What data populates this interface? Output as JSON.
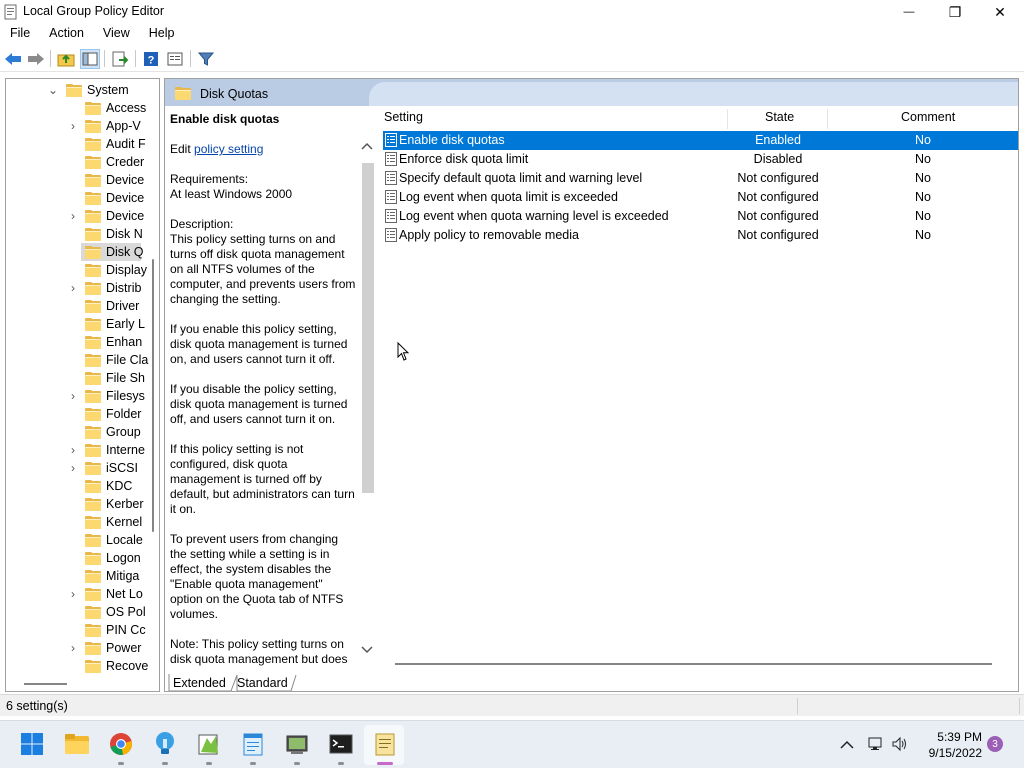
{
  "window": {
    "title": "Local Group Policy Editor",
    "minimize_glyph": "—",
    "maximize_glyph": "❐",
    "close_glyph": "✕"
  },
  "menu": [
    "File",
    "Action",
    "View",
    "Help"
  ],
  "toolbar": {
    "icons": [
      "back-arrow-icon",
      "forward-arrow-icon",
      "up-folder-icon",
      "show-hide-tree-icon",
      "export-list-icon",
      "help-icon",
      "properties-icon",
      "filter-icon"
    ]
  },
  "tree": {
    "items": [
      {
        "label": "System",
        "expander": "⌄",
        "selected": false
      },
      {
        "label": "Access",
        "expander": "",
        "selected": false
      },
      {
        "label": "App-V",
        "expander": "›",
        "selected": false
      },
      {
        "label": "Audit F",
        "expander": "",
        "selected": false
      },
      {
        "label": "Creder",
        "expander": "",
        "selected": false
      },
      {
        "label": "Device",
        "expander": "",
        "selected": false
      },
      {
        "label": "Device",
        "expander": "",
        "selected": false
      },
      {
        "label": "Device",
        "expander": "›",
        "selected": false
      },
      {
        "label": "Disk N",
        "expander": "",
        "selected": false
      },
      {
        "label": "Disk Q",
        "expander": "",
        "selected": true
      },
      {
        "label": "Display",
        "expander": "",
        "selected": false
      },
      {
        "label": "Distrib",
        "expander": "›",
        "selected": false
      },
      {
        "label": "Driver",
        "expander": "",
        "selected": false
      },
      {
        "label": "Early L",
        "expander": "",
        "selected": false
      },
      {
        "label": "Enhan",
        "expander": "",
        "selected": false
      },
      {
        "label": "File Cla",
        "expander": "",
        "selected": false
      },
      {
        "label": "File Sh",
        "expander": "",
        "selected": false
      },
      {
        "label": "Filesys",
        "expander": "›",
        "selected": false
      },
      {
        "label": "Folder",
        "expander": "",
        "selected": false
      },
      {
        "label": "Group",
        "expander": "",
        "selected": false
      },
      {
        "label": "Interne",
        "expander": "›",
        "selected": false
      },
      {
        "label": "iSCSI",
        "expander": "›",
        "selected": false
      },
      {
        "label": "KDC",
        "expander": "",
        "selected": false
      },
      {
        "label": "Kerber",
        "expander": "",
        "selected": false
      },
      {
        "label": "Kernel",
        "expander": "",
        "selected": false
      },
      {
        "label": "Locale",
        "expander": "",
        "selected": false
      },
      {
        "label": "Logon",
        "expander": "",
        "selected": false
      },
      {
        "label": "Mitiga",
        "expander": "",
        "selected": false
      },
      {
        "label": "Net Lo",
        "expander": "›",
        "selected": false
      },
      {
        "label": "OS Pol",
        "expander": "",
        "selected": false
      },
      {
        "label": "PIN Cc",
        "expander": "",
        "selected": false
      },
      {
        "label": "Power",
        "expander": "›",
        "selected": false
      },
      {
        "label": "Recove",
        "expander": "",
        "selected": false
      }
    ]
  },
  "header": {
    "title": "Disk Quotas"
  },
  "description": {
    "heading": "Enable disk quotas",
    "edit_prefix": "Edit ",
    "edit_link": "policy setting",
    "requirements_label": "Requirements:",
    "requirements_value": "At least Windows 2000",
    "description_label": "Description:",
    "paragraphs": [
      "This policy setting turns on and turns off disk quota management on all NTFS volumes of the computer, and prevents users from changing the setting.",
      "If you enable this policy setting, disk quota management is turned on, and users cannot turn it off.",
      "If you disable the policy setting, disk quota management is turned off, and users cannot turn it on.",
      "If this policy setting is not configured, disk quota management is turned off by default, but administrators can turn it on.",
      "To prevent users from changing the setting while a setting is in effect, the system disables the \"Enable quota management\" option on the Quota tab of NTFS volumes.",
      "Note: This policy setting turns on disk quota management but does"
    ]
  },
  "list": {
    "columns": {
      "setting": "Setting",
      "state": "State",
      "comment": "Comment"
    },
    "rows": [
      {
        "name": "Enable disk quotas",
        "state": "Enabled",
        "comment": "No",
        "selected": true
      },
      {
        "name": "Enforce disk quota limit",
        "state": "Disabled",
        "comment": "No",
        "selected": false
      },
      {
        "name": "Specify default quota limit and warning level",
        "state": "Not configured",
        "comment": "No",
        "selected": false
      },
      {
        "name": "Log event when quota limit is exceeded",
        "state": "Not configured",
        "comment": "No",
        "selected": false
      },
      {
        "name": "Log event when quota warning level is exceeded",
        "state": "Not configured",
        "comment": "No",
        "selected": false
      },
      {
        "name": "Apply policy to removable media",
        "state": "Not configured",
        "comment": "No",
        "selected": false
      }
    ]
  },
  "tabs": {
    "extended": "Extended",
    "standard": "Standard",
    "active": "Extended"
  },
  "status": {
    "text": "6 setting(s)"
  },
  "taskbar": {
    "apps": [
      "start-icon",
      "file-explorer-icon",
      "chrome-icon",
      "tips-icon",
      "notepad-plus-icon",
      "notepad-icon",
      "group-policy-icon",
      "terminal-icon",
      "notes-icon"
    ],
    "clock_time": "5:39 PM",
    "clock_date": "9/15/2022",
    "notifications": "3"
  },
  "colors": {
    "selection": "#0078d7",
    "header_band": "#b9cce4",
    "link": "#0645ad",
    "folder": "#fcd970"
  }
}
